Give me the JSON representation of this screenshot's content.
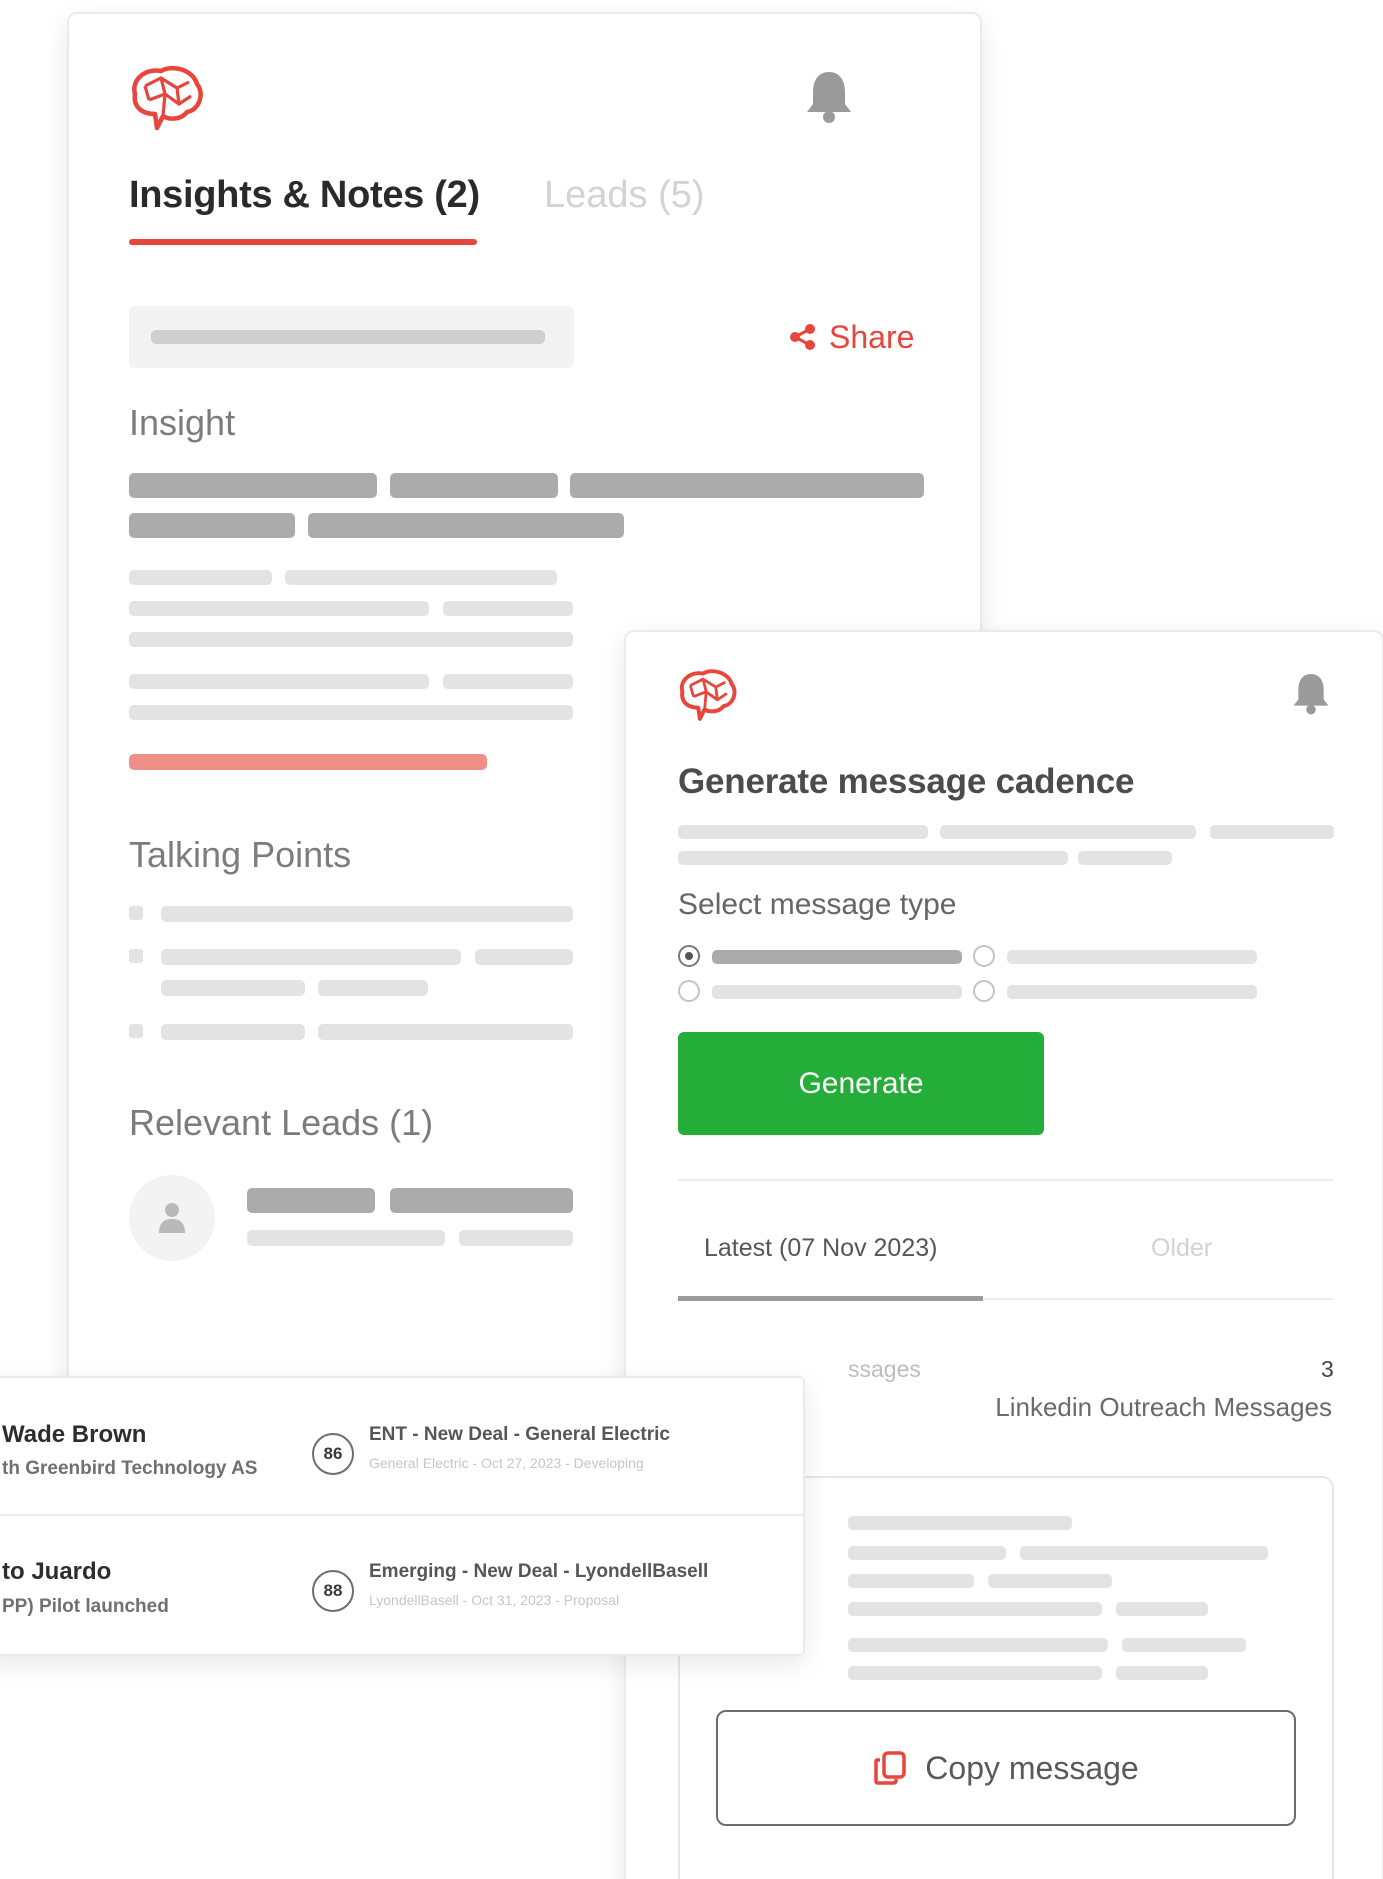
{
  "colors": {
    "accent_red": "#e8453c",
    "generate_green": "#25ad3a",
    "bell_gray": "#9a9a9a"
  },
  "icons": {
    "logo": "brain-logo-icon",
    "notifications": "bell-icon",
    "share": "share-icon",
    "user": "user-icon",
    "copy": "copy-icon"
  },
  "insights_card": {
    "tabs": [
      {
        "label": "Insights & Notes (2)",
        "active": true
      },
      {
        "label": "Leads (5)",
        "active": false
      }
    ],
    "share_label": "Share",
    "sections": {
      "insight": "Insight",
      "talking_points": "Talking Points",
      "relevant_leads": "Relevant Leads (1)"
    }
  },
  "cadence_card": {
    "title": "Generate message cadence",
    "select_label": "Select message type",
    "radio_selected_index": 0,
    "generate_label": "Generate",
    "tabs": {
      "latest": "Latest (07 Nov 2023)",
      "older": "Older"
    },
    "messages_label": "ssages",
    "messages_count": "3",
    "messages_type": "Linkedin Outreach Messages",
    "copy_label": "Copy message"
  },
  "leads_card": {
    "rows": [
      {
        "name": "Wade Brown",
        "company": "th Greenbird Technology AS",
        "score": "86",
        "deal_title": "ENT - New Deal - General Electric",
        "deal_meta": "General Electric - Oct 27, 2023 - Developing"
      },
      {
        "name": "to Juardo",
        "company": "PP) Pilot launched",
        "score": "88",
        "deal_title": "Emerging - New Deal - LyondellBasell",
        "deal_meta": "LyondellBasell - Oct 31, 2023 - Proposal"
      }
    ]
  }
}
